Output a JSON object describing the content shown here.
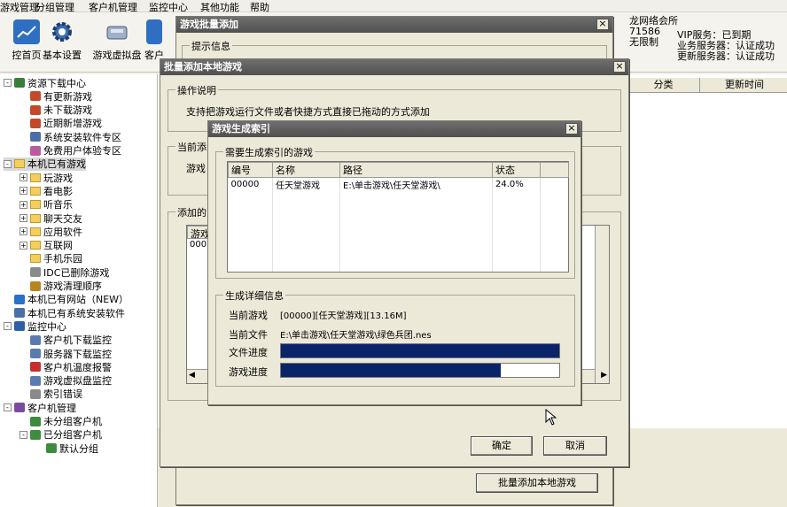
{
  "menu": [
    "游戏管理",
    "分组管理",
    "客户机管理",
    "监控中心",
    "其他功能",
    "帮助"
  ],
  "toolbar": {
    "items": [
      {
        "label": "控首页",
        "icon": "chart-icon"
      },
      {
        "label": "基本设置",
        "icon": "gear-icon"
      },
      {
        "label": "游戏虚拟盘",
        "icon": "disk-icon"
      },
      {
        "label": "客户",
        "icon": "client-icon"
      }
    ]
  },
  "vip": {
    "line1": "龙网络会所",
    "line2": "71586",
    "line3": "无限制",
    "svc": "VIP服务：已到期",
    "biz": "业务服务器：认证成功",
    "upd": "更新服务器：认证成功"
  },
  "columns": {
    "category": "分类",
    "update_time": "更新时间"
  },
  "tree": [
    {
      "label": "资源下载中心",
      "indent": 0,
      "pm": "-",
      "icon": "download-icon"
    },
    {
      "label": "有更新游戏",
      "indent": 1,
      "icon": "user-icon"
    },
    {
      "label": "未下载游戏",
      "indent": 1,
      "icon": "user-icon"
    },
    {
      "label": "近期新增游戏",
      "indent": 1,
      "icon": "user-icon"
    },
    {
      "label": "系统安装软件专区",
      "indent": 1,
      "icon": "app-icon"
    },
    {
      "label": "免费用户体验专区",
      "indent": 1,
      "icon": "gift-icon"
    },
    {
      "label": "本机已有游戏",
      "indent": 0,
      "pm": "-",
      "icon": "folder-icon",
      "selected": true
    },
    {
      "label": "玩游戏",
      "indent": 1,
      "pm": "+",
      "icon": "folder-icon"
    },
    {
      "label": "看电影",
      "indent": 1,
      "pm": "+",
      "icon": "folder-icon"
    },
    {
      "label": "听音乐",
      "indent": 1,
      "pm": "+",
      "icon": "folder-icon"
    },
    {
      "label": "聊天交友",
      "indent": 1,
      "pm": "+",
      "icon": "folder-icon"
    },
    {
      "label": "应用软件",
      "indent": 1,
      "pm": "+",
      "icon": "folder-icon"
    },
    {
      "label": "互联网",
      "indent": 1,
      "pm": "+",
      "icon": "folder-icon"
    },
    {
      "label": "手机乐园",
      "indent": 1,
      "icon": "folder-icon"
    },
    {
      "label": "IDC已删除游戏",
      "indent": 1,
      "icon": "doc-icon"
    },
    {
      "label": "游戏清理顺序",
      "indent": 1,
      "icon": "pen-icon"
    },
    {
      "label": "本机已有网站（NEW）",
      "indent": 0,
      "icon": "ie-icon"
    },
    {
      "label": "本机已有系统安装软件",
      "indent": 0,
      "icon": "app-icon"
    },
    {
      "label": "监控中心",
      "indent": 0,
      "pm": "-",
      "icon": "monitor-icon"
    },
    {
      "label": "客户机下载监控",
      "indent": 1,
      "icon": "list-icon"
    },
    {
      "label": "服务器下载监控",
      "indent": 1,
      "icon": "list-icon"
    },
    {
      "label": "客户机温度报警",
      "indent": 1,
      "icon": "alert-icon"
    },
    {
      "label": "游戏虚拟盘监控",
      "indent": 1,
      "icon": "list-icon"
    },
    {
      "label": "索引错误",
      "indent": 1,
      "icon": "doc-icon"
    },
    {
      "label": "客户机管理",
      "indent": 0,
      "pm": "-",
      "icon": "users-icon"
    },
    {
      "label": "未分组客户机",
      "indent": 1,
      "icon": "pc-icon"
    },
    {
      "label": "已分组客户机",
      "indent": 1,
      "pm": "-",
      "icon": "pc-icon"
    },
    {
      "label": "默认分组",
      "indent": 2,
      "icon": "pc-icon"
    }
  ],
  "dialog1": {
    "title": "游戏批量添加",
    "group_hint": "提示信息",
    "add_button": "批量添加本地游戏"
  },
  "dialog2": {
    "title": "批量添加本地游戏",
    "group_ops": "操作说明",
    "ops_text": "支持把游戏运行文件或者快捷方式直接已拖动的方式添加",
    "group_current": "当前添",
    "current_label": "游戏",
    "group_added": "添加的",
    "table_hdr": "游戏",
    "row_text": "000",
    "ok": "确定",
    "cancel": "取消"
  },
  "dialog3": {
    "title": "游戏生成索引",
    "group_list": "需要生成索引的游戏",
    "headers": {
      "id": "编号",
      "name": "名称",
      "path": "路径",
      "status": "状态"
    },
    "rows": [
      {
        "id": "00000",
        "name": "任天堂游戏",
        "path": "E:\\单击游戏\\任天堂游戏\\",
        "status": "24.0%"
      }
    ],
    "group_detail": "生成详细信息",
    "current_game_label": "当前游戏",
    "current_game": "[00000][任天堂游戏][13.16M]",
    "current_file_label": "当前文件",
    "current_file": "E:\\单击游戏\\任天堂游戏\\绿色兵团.nes",
    "file_progress_label": "文件进度",
    "file_progress": 1.0,
    "game_progress_label": "游戏进度",
    "game_progress": 0.79
  },
  "colors": {
    "titlebar": "#555555",
    "progress": "#0a246a",
    "dialog": "#ece9d8"
  }
}
